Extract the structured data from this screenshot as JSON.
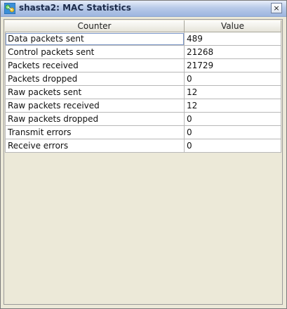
{
  "window": {
    "title": "shasta2: MAC Statistics",
    "close_label": "×",
    "icon": "network-app-icon"
  },
  "table": {
    "columns": [
      "Counter",
      "Value"
    ],
    "rows": [
      {
        "counter": "Data packets sent",
        "value": "489"
      },
      {
        "counter": "Control packets sent",
        "value": "21268"
      },
      {
        "counter": "Packets received",
        "value": "21729"
      },
      {
        "counter": "Packets dropped",
        "value": "0"
      },
      {
        "counter": "Raw packets sent",
        "value": "12"
      },
      {
        "counter": "Raw packets received",
        "value": "12"
      },
      {
        "counter": "Raw packets dropped",
        "value": "0"
      },
      {
        "counter": "Transmit errors",
        "value": "0"
      },
      {
        "counter": "Receive errors",
        "value": "0"
      }
    ]
  }
}
